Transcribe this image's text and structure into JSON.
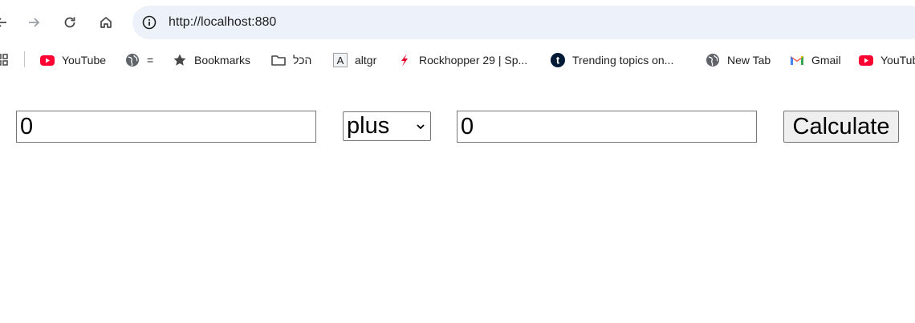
{
  "browser": {
    "url": "http://localhost:880",
    "bookmarks": [
      {
        "label": "YouTube",
        "icon": "youtube-icon"
      },
      {
        "label": "=",
        "icon": "globe-icon"
      },
      {
        "label": "Bookmarks",
        "icon": "star-icon"
      },
      {
        "label": "הכל",
        "icon": "folder-icon"
      },
      {
        "label": "altgr",
        "icon": "letter-a-icon"
      },
      {
        "label": "Rockhopper 29 | Sp...",
        "icon": "specialized-icon"
      },
      {
        "label": "Trending topics on...",
        "icon": "tumblr-icon"
      },
      {
        "label": "New Tab",
        "icon": "globe-icon"
      },
      {
        "label": "Gmail",
        "icon": "gmail-icon"
      },
      {
        "label": "YouTube",
        "icon": "youtube-icon"
      }
    ]
  },
  "calculator": {
    "first_value": "0",
    "operator": "plus",
    "second_value": "0",
    "calculate_label": "Calculate"
  },
  "colors": {
    "youtube_red": "#ff0033",
    "omnibox_bg": "#edf2fa",
    "button_bg": "#efefef"
  }
}
